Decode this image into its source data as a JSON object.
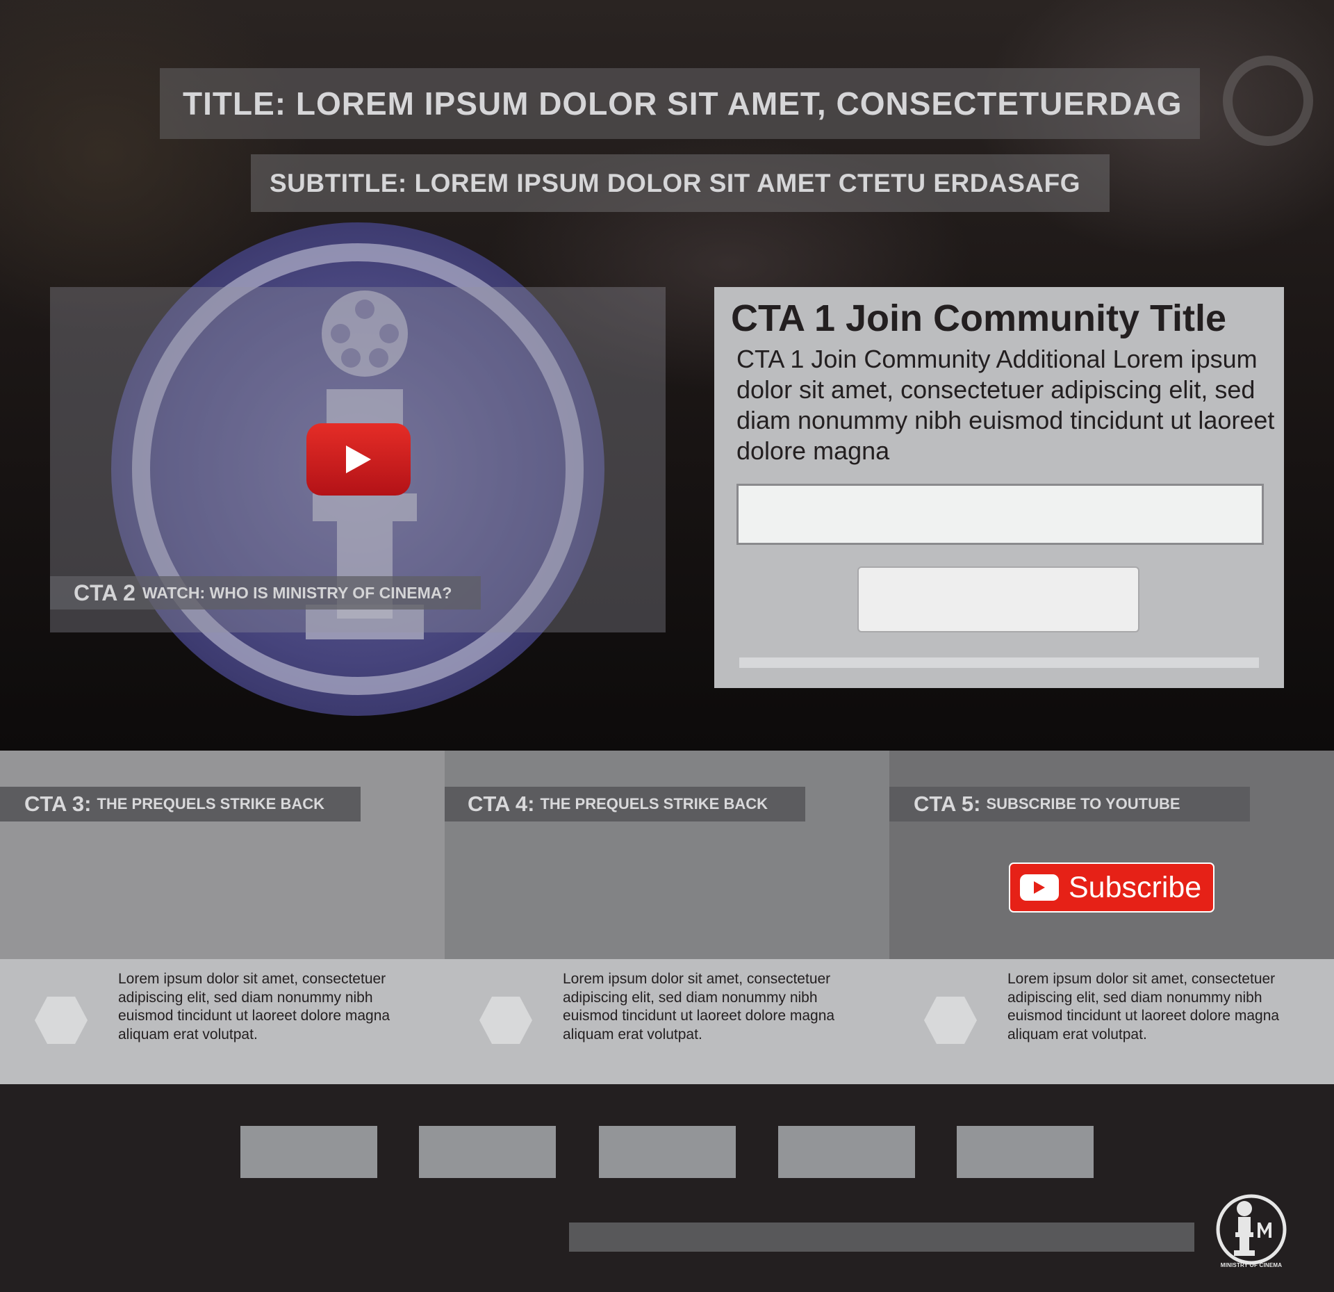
{
  "header": {
    "title": "TITLE: LOREM IPSUM DOLOR SIT AMET, CONSECTETUERDAG",
    "subtitle": "SUBTITLE: LOREM IPSUM DOLOR SIT AMET CTETU ERDASAFG"
  },
  "video": {
    "play_icon": "youtube-play-icon",
    "cta_prefix": "CTA 2",
    "cta_label": "WATCH: WHO IS MINISTRY OF CINEMA?"
  },
  "cta1": {
    "title": "CTA 1 Join Community Title",
    "body": "CTA 1 Join Community Additional Lorem ipsum dolor sit amet, consectetuer adipiscing elit, sed diam nonummy nibh euismod tincidunt ut laoreet dolore magna",
    "input_value": "",
    "button_label": ""
  },
  "columns": [
    {
      "prefix": "CTA 3:",
      "label": "THE PREQUELS STRIKE BACK",
      "text": "Lorem ipsum dolor sit amet, consectetuer adipiscing elit, sed diam nonummy nibh euismod tincidunt ut laoreet dolore magna aliquam erat volutpat."
    },
    {
      "prefix": "CTA 4:",
      "label": "THE PREQUELS STRIKE BACK",
      "text": "Lorem ipsum dolor sit amet, consectetuer adipiscing elit, sed diam nonummy nibh euismod tincidunt ut laoreet dolore magna aliquam erat volutpat."
    },
    {
      "prefix": "CTA 5:",
      "label": "SUBSCRIBE TO YOUTUBE",
      "text": "Lorem ipsum dolor sit amet, consectetuer adipiscing elit, sed diam nonummy nibh euismod tincidunt ut laoreet dolore magna aliquam erat volutpat."
    }
  ],
  "subscribe": {
    "label": "Subscribe",
    "icon": "youtube-play-icon"
  },
  "footer": {
    "logo_text": "MINISTRY OF CINEMA",
    "link_count_shown": 5
  },
  "colors": {
    "youtube_red": "#e62117",
    "panel_gray": "#bcbdbf",
    "dark_bg": "#231f20"
  }
}
